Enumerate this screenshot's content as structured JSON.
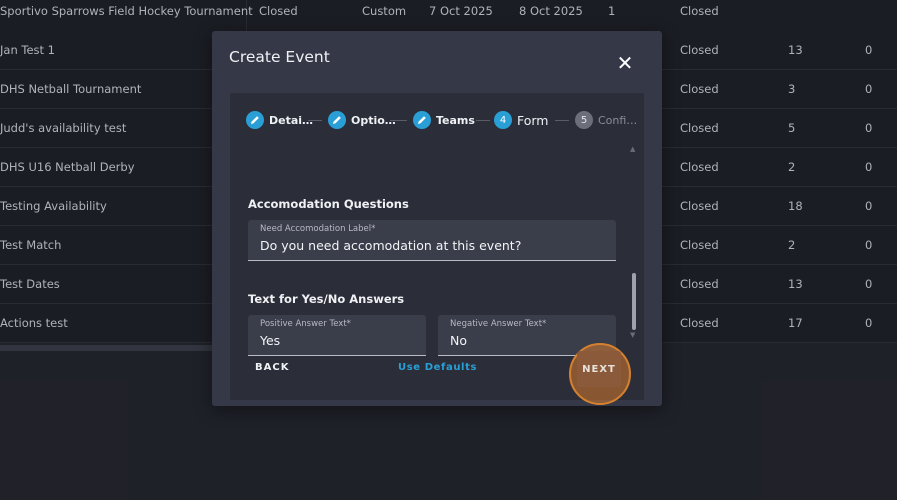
{
  "table": {
    "rows": [
      {
        "name": "Sportivo Sparrows Field Hockey Tournament",
        "status": "Closed",
        "type": "Custom",
        "start": "7 Oct 2025",
        "end": "8 Oct 2025",
        "count": "1",
        "state": "Closed",
        "a": "",
        "b": ""
      },
      {
        "name": "Jan Test 1",
        "state": "Closed",
        "a": "13",
        "b": "0"
      },
      {
        "name": "DHS Netball Tournament",
        "state": "Closed",
        "a": "3",
        "b": "0"
      },
      {
        "name": "Judd's availability test",
        "state": "Closed",
        "a": "5",
        "b": "0"
      },
      {
        "name": "DHS U16 Netball Derby",
        "state": "Closed",
        "a": "2",
        "b": "0"
      },
      {
        "name": "Testing Availability",
        "state": "Closed",
        "a": "18",
        "b": "0"
      },
      {
        "name": "Test Match",
        "state": "Closed",
        "a": "2",
        "b": "0"
      },
      {
        "name": "Test Dates",
        "state": "Closed",
        "a": "13",
        "b": "0"
      },
      {
        "name": "Actions test",
        "state": "Closed",
        "a": "17",
        "b": "0"
      }
    ]
  },
  "modal": {
    "title": "Create Event",
    "close_icon": "close-icon",
    "steps": [
      {
        "label": "Detai…",
        "state": "done",
        "icon": "pencil-icon"
      },
      {
        "label": "Optio…",
        "state": "done",
        "icon": "pencil-icon"
      },
      {
        "label": "Teams",
        "state": "done",
        "icon": "pencil-icon"
      },
      {
        "label": "Form",
        "state": "active",
        "number": "4"
      },
      {
        "label": "Confi…",
        "state": "inactive",
        "number": "5"
      }
    ],
    "accommodation": {
      "section_title": "Accomodation Questions",
      "label_field": {
        "label": "Need Accomodation Label*",
        "value": "Do you need accomodation at this event?"
      }
    },
    "answers": {
      "section_title": "Text for Yes/No Answers",
      "positive": {
        "label": "Positive Answer Text*",
        "value": "Yes"
      },
      "negative": {
        "label": "Negative Answer Text*",
        "value": "No"
      }
    },
    "buttons": {
      "back": "BACK",
      "defaults": "Use Defaults",
      "next": "NEXT"
    },
    "colors": {
      "accent": "#2a9fd6",
      "highlight": "#d5812f"
    }
  }
}
